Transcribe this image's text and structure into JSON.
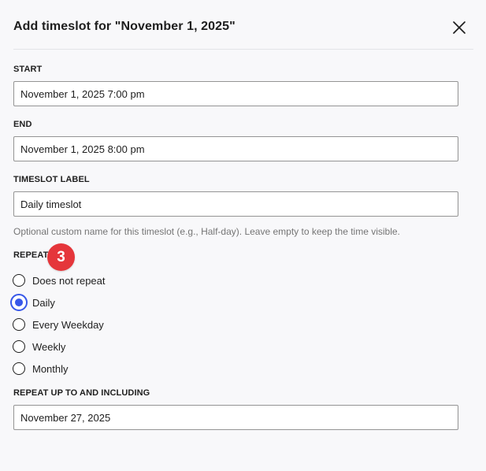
{
  "dialog": {
    "title": "Add timeslot for \"November 1, 2025\""
  },
  "fields": {
    "start": {
      "label": "START",
      "value": "November 1, 2025 7:00 pm"
    },
    "end": {
      "label": "END",
      "value": "November 1, 2025 8:00 pm"
    },
    "timeslot_label": {
      "label": "TIMESLOT LABEL",
      "value": "Daily timeslot",
      "help": "Optional custom name for this timeslot (e.g., Half-day). Leave empty to keep the time visible."
    },
    "repeat": {
      "label": "REPEAT",
      "badge": "3",
      "options": [
        {
          "label": "Does not repeat",
          "selected": false
        },
        {
          "label": "Daily",
          "selected": true
        },
        {
          "label": "Every Weekday",
          "selected": false
        },
        {
          "label": "Weekly",
          "selected": false
        },
        {
          "label": "Monthly",
          "selected": false
        }
      ]
    },
    "repeat_until": {
      "label": "REPEAT UP TO AND INCLUDING",
      "value": "November 27, 2025"
    }
  },
  "icons": {
    "close": "close-icon"
  },
  "colors": {
    "accent": "#3858e9",
    "badge": "#e5363b",
    "background": "#f8f8fa"
  }
}
